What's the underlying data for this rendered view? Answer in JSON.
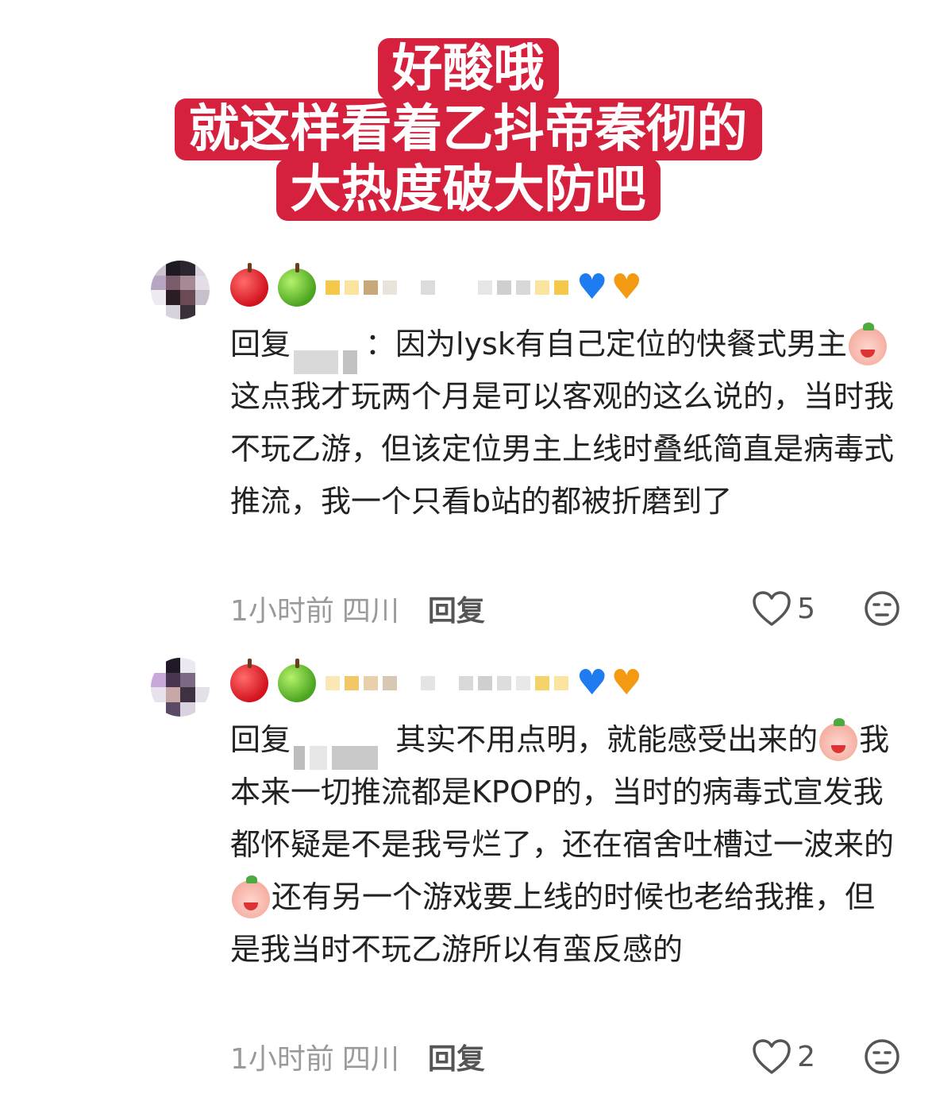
{
  "title": {
    "lines": [
      "好酸哦",
      "就这样看着乙抖帝秦彻的",
      "大热度破大防吧"
    ]
  },
  "colors": {
    "title_bg": "#d5213e",
    "meta_gray": "#9a9a9a"
  },
  "comments": [
    {
      "reply_prefix": "回复",
      "text_parts": [
        "：因为lysk有自己定位的快餐式男主",
        "这点我才玩两个月是可以客观的这么说的，当时我不玩乙游，但该定位男主上线时叠纸简直是病毒式推流，我一个只看b站的都被折磨到了"
      ],
      "time": "1小时前",
      "location": "四川",
      "reply_label": "回复",
      "likes": "5",
      "icons": [
        "red-apple-icon",
        "green-apple-icon",
        "blue-heart-icon",
        "orange-heart-icon",
        "crying-face-icon"
      ]
    },
    {
      "reply_prefix": "回复",
      "text_parts": [
        " 其实不用点明，就能感受出来的",
        "我本来一切推流都是KPOP的，当时的病毒式宣发我都怀疑是不是我号烂了，还在宿舍吐槽过一波来的",
        "还有另一个游戏要上线的时候也老给我推，但是我当时不玩乙游所以有蛮反感的"
      ],
      "time": "1小时前",
      "location": "四川",
      "reply_label": "回复",
      "likes": "2",
      "icons": [
        "red-apple-icon",
        "green-apple-icon",
        "blue-heart-icon",
        "orange-heart-icon",
        "crying-face-icon",
        "smiling-face-icon"
      ]
    }
  ]
}
